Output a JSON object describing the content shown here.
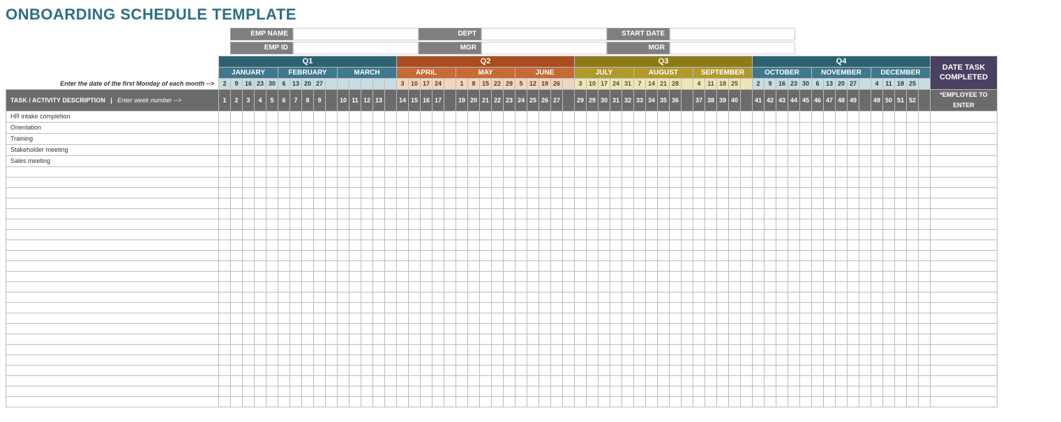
{
  "title": "ONBOARDING SCHEDULE TEMPLATE",
  "form_labels": {
    "emp_name": "EMP NAME",
    "emp_id": "EMP ID",
    "dept": "DEPT",
    "mgr": "MGR",
    "start_date": "START DATE",
    "mgr2": "MGR"
  },
  "date_hint": "Enter the date of the first Monday of each month -->",
  "task_header": "TASK / ACTIVITY DESCRIPTION",
  "week_hint": "Enter week number -->",
  "date_completed_header": "DATE TASK COMPLETED",
  "employee_enter": "*EMPLOYEE TO ENTER",
  "quarters": [
    "Q1",
    "Q2",
    "Q3",
    "Q4"
  ],
  "months": [
    {
      "name": "JANUARY",
      "dates": [
        "2",
        "9",
        "16",
        "23",
        "30"
      ],
      "weeks": [
        "1",
        "2",
        "3",
        "4",
        "5"
      ]
    },
    {
      "name": "FEBRUARY",
      "dates": [
        "6",
        "13",
        "20",
        "27",
        ""
      ],
      "weeks": [
        "6",
        "7",
        "8",
        "9",
        ""
      ]
    },
    {
      "name": "MARCH",
      "dates": [
        "",
        "",
        "",
        "",
        ""
      ],
      "weeks": [
        "10",
        "11",
        "12",
        "13",
        ""
      ]
    },
    {
      "name": "APRIL",
      "dates": [
        "3",
        "10",
        "17",
        "24",
        ""
      ],
      "weeks": [
        "14",
        "15",
        "16",
        "17",
        ""
      ]
    },
    {
      "name": "MAY",
      "dates": [
        "1",
        "8",
        "15",
        "22",
        "29"
      ],
      "weeks": [
        "19",
        "20",
        "21",
        "22",
        "23"
      ]
    },
    {
      "name": "JUNE",
      "dates": [
        "5",
        "12",
        "19",
        "26",
        ""
      ],
      "weeks": [
        "24",
        "25",
        "26",
        "27",
        ""
      ]
    },
    {
      "name": "JULY",
      "dates": [
        "3",
        "10",
        "17",
        "24",
        "31"
      ],
      "weeks": [
        "29",
        "29",
        "30",
        "31",
        "32"
      ]
    },
    {
      "name": "AUGUST",
      "dates": [
        "7",
        "14",
        "21",
        "28",
        ""
      ],
      "weeks": [
        "33",
        "34",
        "35",
        "36",
        ""
      ]
    },
    {
      "name": "SEPTEMBER",
      "dates": [
        "4",
        "11",
        "18",
        "25",
        ""
      ],
      "weeks": [
        "37",
        "38",
        "39",
        "40",
        ""
      ]
    },
    {
      "name": "OCTOBER",
      "dates": [
        "2",
        "9",
        "16",
        "23",
        "30"
      ],
      "weeks": [
        "41",
        "42",
        "43",
        "44",
        "45"
      ]
    },
    {
      "name": "NOVEMBER",
      "dates": [
        "6",
        "13",
        "20",
        "27",
        ""
      ],
      "weeks": [
        "46",
        "47",
        "48",
        "49",
        ""
      ]
    },
    {
      "name": "DECEMBER",
      "dates": [
        "4",
        "11",
        "18",
        "25",
        ""
      ],
      "weeks": [
        "49",
        "50",
        "51",
        "52",
        ""
      ]
    }
  ],
  "tasks": [
    "HR intake completion",
    "Orientation",
    "Training",
    "Stakeholder meeting",
    "Sales meeting",
    "",
    "",
    "",
    "",
    "",
    "",
    "",
    "",
    "",
    "",
    "",
    "",
    "",
    "",
    "",
    "",
    "",
    "",
    "",
    "",
    "",
    "",
    ""
  ],
  "shaded_months": [
    1,
    4,
    7,
    10
  ]
}
